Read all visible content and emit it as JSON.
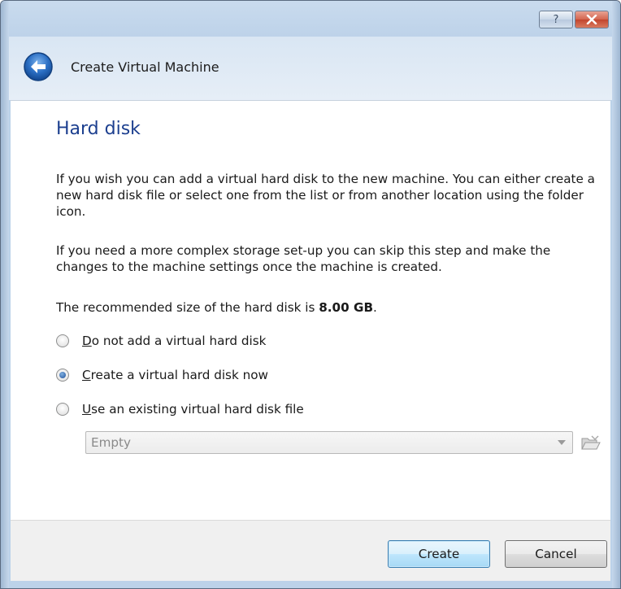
{
  "window": {
    "title": "Create Virtual Machine"
  },
  "page": {
    "title": "Hard disk",
    "paragraph1": "If you wish you can add a virtual hard disk to the new machine. You can either create a new hard disk file or select one from the list or from another location using the folder icon.",
    "paragraph2": "If you need a more complex storage set-up you can skip this step and make the changes to the machine settings once the machine is created.",
    "recommended_prefix": "The recommended size of the hard disk is ",
    "recommended_size": "8.00 GB",
    "recommended_suffix": "."
  },
  "options": [
    {
      "mnemonic": "D",
      "rest": "o not add a virtual hard disk",
      "selected": false
    },
    {
      "mnemonic": "C",
      "rest": "reate a virtual hard disk now",
      "selected": true
    },
    {
      "mnemonic": "U",
      "rest": "se an existing virtual hard disk file",
      "selected": false
    }
  ],
  "disk_select": {
    "value": "Empty"
  },
  "buttons": {
    "create": "Create",
    "cancel": "Cancel"
  },
  "icons": {
    "help": "help-icon",
    "close": "close-icon",
    "back": "back-arrow-icon",
    "folder": "folder-open-icon",
    "dropdown": "chevron-down-icon"
  }
}
